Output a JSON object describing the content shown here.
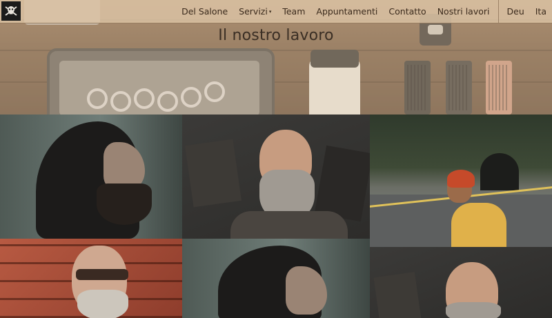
{
  "nav": {
    "items": [
      {
        "label": "Del Salone"
      },
      {
        "label": "Servizi",
        "caret": "▾"
      },
      {
        "label": "Team"
      },
      {
        "label": "Appuntamenti"
      },
      {
        "label": "Contatto"
      },
      {
        "label": "Nostri lavori"
      }
    ],
    "languages": [
      {
        "label": "Deu"
      },
      {
        "label": "Ita"
      }
    ]
  },
  "hero": {
    "title": "Il nostro lavoro"
  },
  "gallery": {
    "tiles": [
      {
        "subject": "bearded man profile, dark backdrop"
      },
      {
        "subject": "bald man with grey beard and glasses"
      },
      {
        "subject": "man with red beanie on road by tunnel"
      },
      {
        "subject": "grey-haired man with sunglasses, brick wall"
      },
      {
        "subject": "bearded man profile, dark backdrop"
      },
      {
        "subject": "bald man with grey beard and glasses"
      }
    ]
  },
  "colors": {
    "nav_bg": "#dcc3a5",
    "nav_text": "#3a2a1c",
    "title_text": "#3a2e24"
  }
}
